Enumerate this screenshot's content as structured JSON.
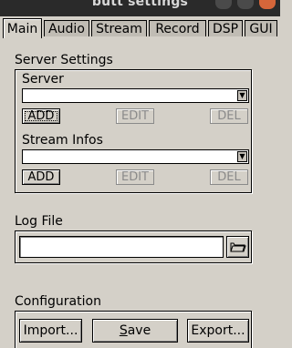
{
  "window": {
    "title": "butt settings"
  },
  "tabs": [
    {
      "label": "Main",
      "active": true
    },
    {
      "label": "Audio",
      "active": false
    },
    {
      "label": "Stream",
      "active": false
    },
    {
      "label": "Record",
      "active": false
    },
    {
      "label": "DSP",
      "active": false
    },
    {
      "label": "GUI",
      "active": false
    }
  ],
  "server_settings": {
    "heading": "Server Settings",
    "server": {
      "label": "Server",
      "value": "",
      "add": "ADD",
      "edit": "EDIT",
      "del": "DEL"
    },
    "stream_infos": {
      "label": "Stream Infos",
      "value": "",
      "add": "ADD",
      "edit": "EDIT",
      "del": "DEL"
    }
  },
  "log_file": {
    "label": "Log File",
    "value": "",
    "browse_icon": "folder-open-icon"
  },
  "configuration": {
    "label": "Configuration",
    "import": "Import...",
    "save_pre": "",
    "save_ul": "S",
    "save_post": "ave",
    "export": "Export..."
  }
}
